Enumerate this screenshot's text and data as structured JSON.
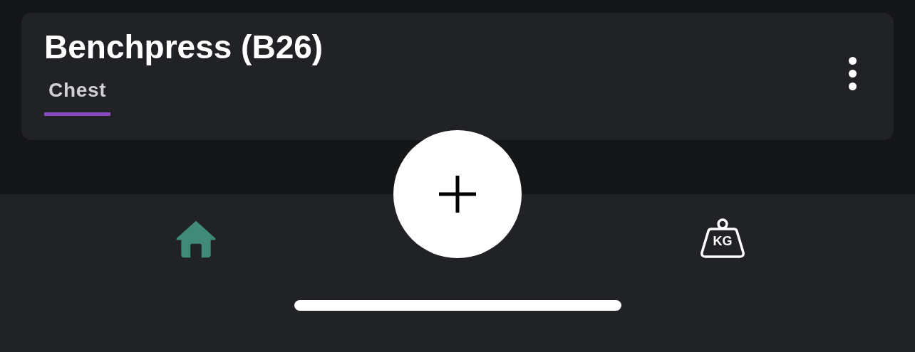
{
  "exercise_card": {
    "title": "Benchpress (B26)",
    "tags": [
      {
        "label": "Chest",
        "selected": true
      }
    ]
  },
  "bottom_nav": {
    "items": [
      {
        "kind": "home",
        "selected": true
      },
      {
        "kind": "weights",
        "label": "KG",
        "selected": false
      }
    ]
  }
}
